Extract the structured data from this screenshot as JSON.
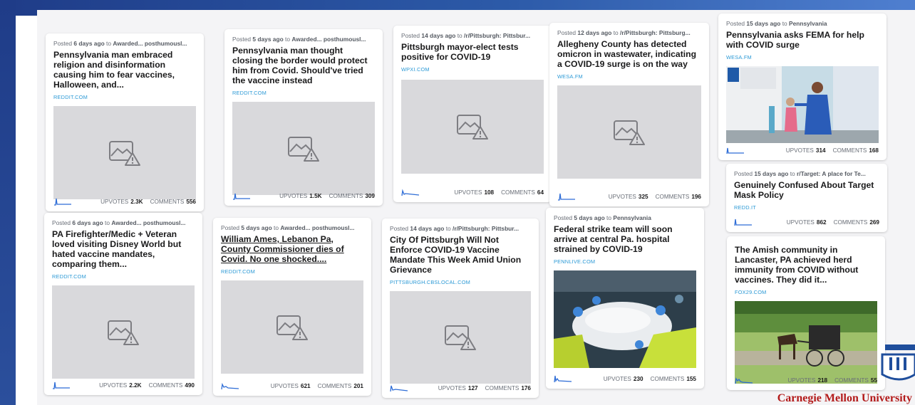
{
  "cards": [
    {
      "posted_prefix": "Posted",
      "age": "6 days ago",
      "to": "to",
      "community": "Awarded... posthumousl...",
      "title": "Pennsylvania man embraced religion and disinformation causing him to fear vaccines, Halloween, and...",
      "domain": "REDDIT.COM",
      "upvotes_label": "UPVOTES",
      "upvotes": "2.3K",
      "comments_label": "COMMENTS",
      "comments": "556",
      "image": "broken"
    },
    {
      "posted_prefix": "Posted",
      "age": "5 days ago",
      "to": "to",
      "community": "Awarded... posthumousl...",
      "title": "Pennsylvania man thought closing the border would protect him from Covid. Should've tried the vaccine instead",
      "domain": "REDDIT.COM",
      "upvotes_label": "UPVOTES",
      "upvotes": "1.5K",
      "comments_label": "COMMENTS",
      "comments": "309",
      "image": "broken"
    },
    {
      "posted_prefix": "Posted",
      "age": "14 days ago",
      "to": "to",
      "community": "/r/Pittsburgh: Pittsbur...",
      "title": "Pittsburgh mayor-elect tests positive for COVID-19",
      "domain": "WPXI.COM",
      "upvotes_label": "UPVOTES",
      "upvotes": "108",
      "comments_label": "COMMENTS",
      "comments": "64",
      "image": "broken"
    },
    {
      "posted_prefix": "Posted",
      "age": "12 days ago",
      "to": "to",
      "community": "/r/Pittsburgh: Pittsburg...",
      "title": "Allegheny County has detected omicron in wastewater, indicating a COVID-19 surge is on the way",
      "domain": "WESA.FM",
      "upvotes_label": "UPVOTES",
      "upvotes": "325",
      "comments_label": "COMMENTS",
      "comments": "196",
      "image": "broken"
    },
    {
      "posted_prefix": "Posted",
      "age": "15 days ago",
      "to": "to",
      "community": "Pennsylvania",
      "title": "Pennsylvania asks FEMA for help with COVID surge",
      "domain": "WESA.FM",
      "upvotes_label": "UPVOTES",
      "upvotes": "314",
      "comments_label": "COMMENTS",
      "comments": "168",
      "image": "testing"
    },
    {
      "posted_prefix": "Posted",
      "age": "15 days ago",
      "to": "to",
      "community": "r/Target: A place for Te...",
      "title": "Genuinely Confused About Target Mask Policy",
      "domain": "REDD.IT",
      "upvotes_label": "UPVOTES",
      "upvotes": "862",
      "comments_label": "COMMENTS",
      "comments": "269",
      "image": "none"
    },
    {
      "posted_prefix": "Posted",
      "age": "6 days ago",
      "to": "to",
      "community": "Awarded... posthumousl...",
      "title": "PA Firefighter/Medic + Veteran loved visiting Disney World but hated vaccine mandates, comparing them...",
      "domain": "REDDIT.COM",
      "upvotes_label": "UPVOTES",
      "upvotes": "2.2K",
      "comments_label": "COMMENTS",
      "comments": "490",
      "image": "broken"
    },
    {
      "posted_prefix": "Posted",
      "age": "5 days ago",
      "to": "to",
      "community": "Awarded... posthumousl...",
      "title": "William Ames, Lebanon Pa, County Commissioner dies of Covid. No one shocked....",
      "domain": "REDDIT.COM",
      "upvotes_label": "UPVOTES",
      "upvotes": "621",
      "comments_label": "COMMENTS",
      "comments": "201",
      "image": "broken"
    },
    {
      "posted_prefix": "Posted",
      "age": "14 days ago",
      "to": "to",
      "community": "/r/Pittsburgh: Pittsbur...",
      "title": "City Of Pittsburgh Will Not Enforce COVID-19 Vaccine Mandate This Week Amid Union Grievance",
      "domain": "PITTSBURGH.CBSLOCAL.COM",
      "upvotes_label": "UPVOTES",
      "upvotes": "127",
      "comments_label": "COMMENTS",
      "comments": "176",
      "image": "broken"
    },
    {
      "posted_prefix": "Posted",
      "age": "5 days ago",
      "to": "to",
      "community": "Pennsylvania",
      "title": "Federal strike team will soon arrive at central Pa. hospital strained by COVID-19",
      "domain": "PENNLIVE.COM",
      "upvotes_label": "UPVOTES",
      "upvotes": "230",
      "comments_label": "COMMENTS",
      "comments": "155",
      "image": "hospital"
    },
    {
      "posted_prefix": "",
      "age": "",
      "to": "",
      "community": "",
      "title": "The Amish community in Lancaster, PA achieved herd immunity from COVID without vaccines. They did it...",
      "domain": "FOX29.COM",
      "upvotes_label": "UPVOTES",
      "upvotes": "218",
      "comments_label": "COMMENTS",
      "comments": "55",
      "image": "amish"
    }
  ],
  "branding": {
    "text": "Carnegie Mellon University"
  },
  "colors": {
    "banner": "#1f3c88",
    "domain": "#2d9ad6",
    "brand_red": "#b31b1b"
  }
}
